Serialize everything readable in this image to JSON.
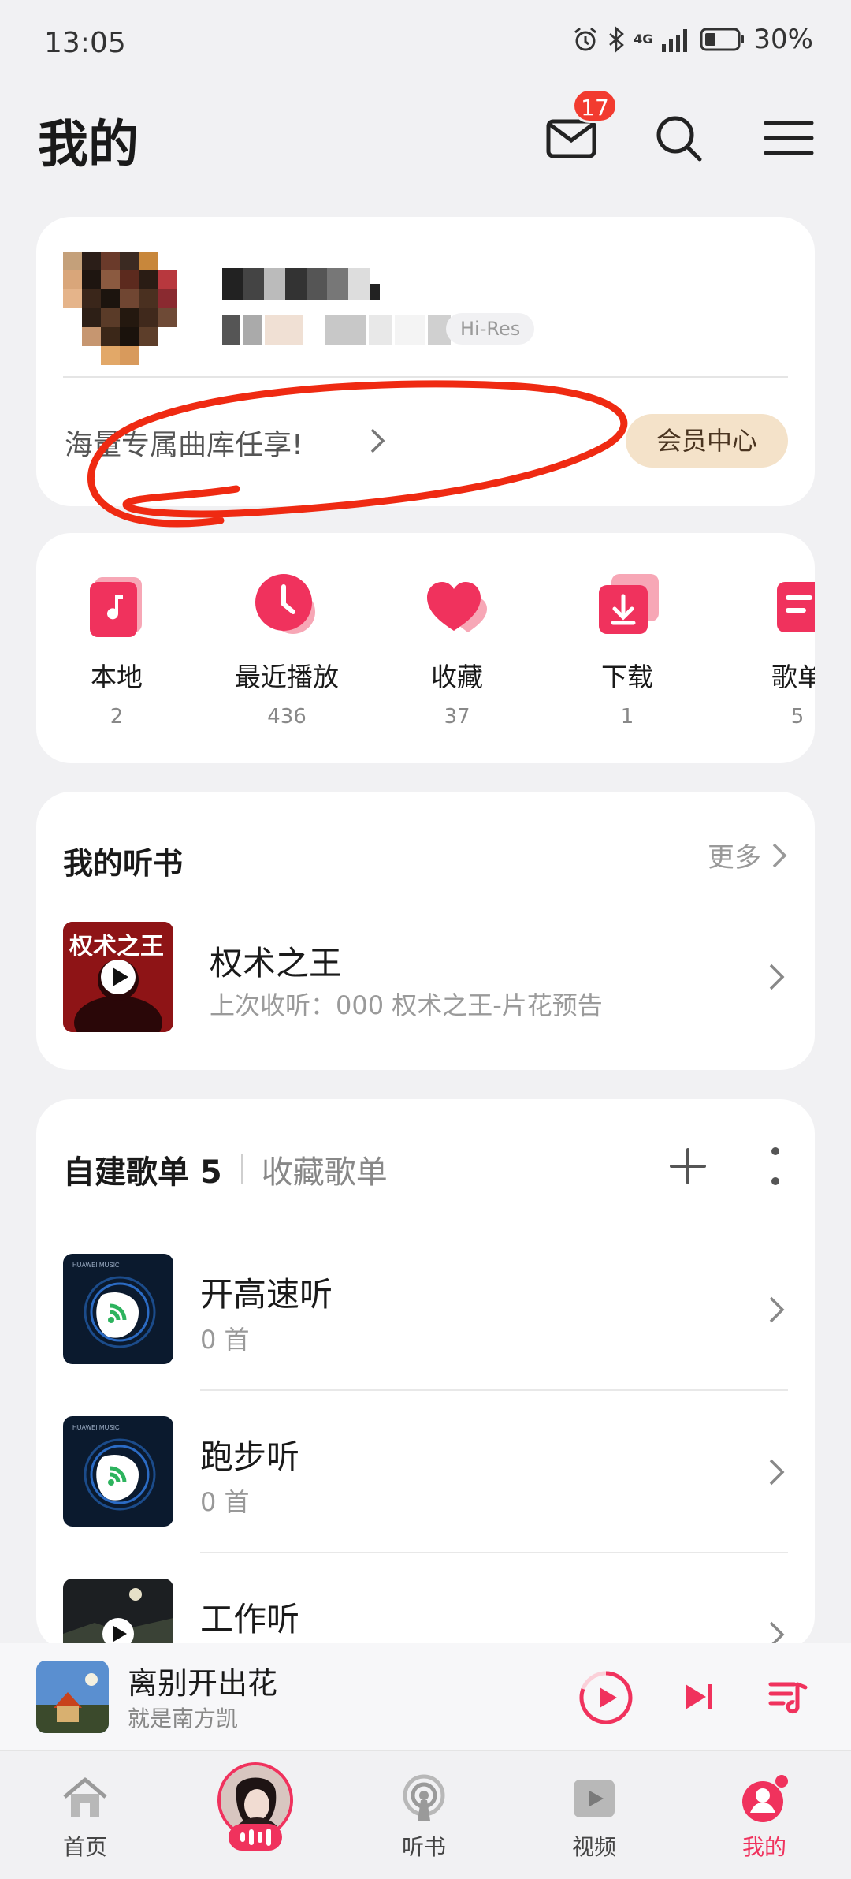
{
  "status_bar": {
    "time": "13:05",
    "network": "4G",
    "battery": "30%"
  },
  "header": {
    "title": "我的",
    "mail_badge": "17"
  },
  "profile": {
    "hires_label": "Hi-Res",
    "promo_text": "海量专属曲库任享!",
    "vip_button": "会员中心"
  },
  "quick_actions": [
    {
      "label": "本地",
      "count": "2",
      "icon": "music-note-icon"
    },
    {
      "label": "最近播放",
      "count": "436",
      "icon": "clock-icon"
    },
    {
      "label": "收藏",
      "count": "37",
      "icon": "heart-icon"
    },
    {
      "label": "下载",
      "count": "1",
      "icon": "download-icon"
    },
    {
      "label": "歌单",
      "count": "5",
      "icon": "playlist-icon"
    }
  ],
  "audiobooks": {
    "title": "我的听书",
    "more": "更多",
    "item": {
      "cover_text": "权术之王",
      "title": "权术之王",
      "subtitle": "上次收听：000 权术之王-片花预告"
    }
  },
  "playlists": {
    "tab_active": "自建歌单 5",
    "tab_inactive": "收藏歌单",
    "items": [
      {
        "name": "开高速听",
        "count": "0 首",
        "cover_brand": "HUAWEI MUSIC"
      },
      {
        "name": "跑步听",
        "count": "0 首",
        "cover_brand": "HUAWEI MUSIC"
      },
      {
        "name": "工作听",
        "count": ""
      }
    ]
  },
  "now_playing": {
    "title": "离别开出花",
    "artist": "就是南方凯"
  },
  "tab_bar": {
    "items": [
      {
        "label": "首页",
        "icon": "home-icon"
      },
      {
        "label": "",
        "icon": "now-playing-disc-icon"
      },
      {
        "label": "听书",
        "icon": "podcast-icon"
      },
      {
        "label": "视频",
        "icon": "video-icon"
      },
      {
        "label": "我的",
        "icon": "profile-icon"
      }
    ],
    "active": "我的"
  },
  "colors": {
    "accent": "#f0325d",
    "badge": "#f23b2f",
    "vip_bg": "#f4e2c9",
    "annotation": "#ef2a12"
  }
}
